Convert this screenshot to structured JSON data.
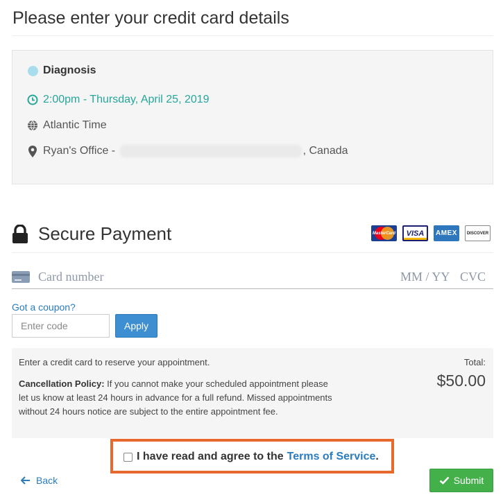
{
  "page": {
    "title": "Please enter your credit card details"
  },
  "appointment": {
    "service": "Diagnosis",
    "service_color": "#a9dcec",
    "time": "2:00pm - Thursday, April 25, 2019",
    "time_color": "#26a69a",
    "timezone": "Atlantic Time",
    "location_prefix": "Ryan's Office - ",
    "location_suffix": ", Canada",
    "icons": {
      "time": "clock-icon",
      "timezone": "globe-icon",
      "location": "map-pin-icon"
    }
  },
  "payment": {
    "title": "Secure Payment",
    "icon": "lock-icon",
    "card_brands": [
      {
        "name": "mastercard-logo",
        "label": "MasterCard"
      },
      {
        "name": "visa-logo",
        "label": "VISA"
      },
      {
        "name": "amex-logo",
        "label": "AMEX"
      },
      {
        "name": "discover-logo",
        "label": "DISCOVER"
      }
    ],
    "card_placeholder": "Card number",
    "expiry_placeholder": "MM / YY",
    "cvc_placeholder": "CVC"
  },
  "coupon": {
    "link_text": "Got a coupon?",
    "input_placeholder": "Enter code",
    "apply_label": "Apply"
  },
  "summary": {
    "reserve_note": "Enter a credit card to reserve your appointment.",
    "policy_label": "Cancellation Policy:",
    "policy_text": " If you cannot make your scheduled appointment please let us know at least 24 hours in advance for a full refund. Missed appointments without 24 hours notice are subject to the entire appointment fee.",
    "total_label": "Total:",
    "total_value": "$50.00"
  },
  "terms": {
    "agree_text": "I have read and agree to the",
    "link_text": "Terms of Service",
    "trailing": ".",
    "checked": false,
    "highlight_color": "#e8692e"
  },
  "footer": {
    "back_label": "Back",
    "submit_label": "Submit",
    "submit_color": "#43b04a"
  }
}
